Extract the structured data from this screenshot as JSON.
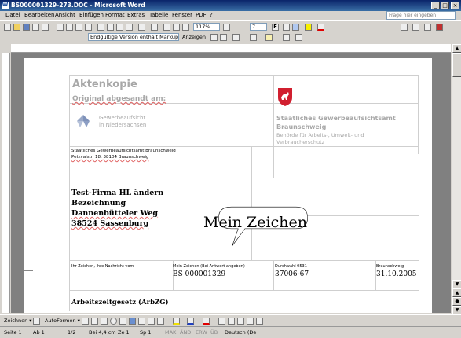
{
  "window": {
    "title": "BS000001329-273.DOC - Microsoft Word",
    "min": "_",
    "max": "□",
    "close": "×"
  },
  "menu": [
    "Datei",
    "Bearbeiten",
    "Ansicht",
    "Einfügen",
    "Format",
    "Extras",
    "Tabelle",
    "Fenster",
    "PDF",
    "?"
  ],
  "help_placeholder": "Frage hier eingeben",
  "toolbar": {
    "zoom": "117%",
    "font_size": "7",
    "view_mode": "Endgültige Version enthält Markups",
    "show_label": "Anzeigen"
  },
  "document": {
    "header_title": "Aktenkopie",
    "header_subtitle": "Original abgesandt am:",
    "logo_text1": "Gewerbeaufsicht",
    "logo_text2": "in Niedersachsen",
    "office_name1": "Staatliches Gewerbeaufsichtsamt",
    "office_name2": "Braunschweig",
    "office_sub1": "Behörde für Arbeits-, Umwelt- und",
    "office_sub2": "Verbraucherschutz",
    "sender_line1": "Staatliches Gewerbeaufsichtsamt Braunschweig",
    "sender_line2": "Petzvalstr. 18, 38104 Braunschweig",
    "addr1": "Test-Firma HL ändern",
    "addr2": "Bezeichnung",
    "addr3": "Dannenbütteler Weg",
    "addr4": "38524 Sassenburg",
    "ref_h1": "Ihr Zeichen, Ihre Nachricht vom",
    "ref_h2": "Mein Zeichen (Bei Antwort angeben)",
    "ref_h3": "Durchwahl 0531",
    "ref_h4": "Braunschweig",
    "ref_v2": "BS 000001329",
    "ref_v3": "37006-67",
    "ref_v4": "31.10.2005",
    "subject": "Arbeitszeitgesetz (ArbZG)"
  },
  "callout_text": "Mein Zeichen",
  "drawbar": {
    "draw": "Zeichnen ▾",
    "autoshapes": "AutoFormen ▾"
  },
  "status": {
    "page": "Seite 1",
    "section": "Ab 1",
    "pages": "1/2",
    "pos": "Bei 4,4 cm",
    "line": "Ze 1",
    "col": "Sp 1",
    "mak": "MAK",
    "aend": "ÄND",
    "erw": "ERW",
    "ub": "ÜB",
    "lang": "Deutsch (De"
  }
}
